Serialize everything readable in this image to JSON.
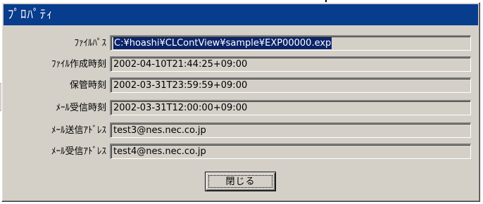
{
  "dialog": {
    "title": "ﾌﾟﾛﾊﾟﾃｨ",
    "colors": {
      "titlebar": "#083c8c",
      "face": "#d4d0c8",
      "selection": "#0a246a"
    }
  },
  "fields": [
    {
      "label": "ﾌｧｲﾙﾊﾟｽ",
      "value": "C:¥hoashi¥CLContView¥sample¥EXP00000.exp",
      "selected": true
    },
    {
      "label": "ﾌｧｲﾙ作成時刻",
      "value": "2002-04-10T21:44:25+09:00"
    },
    {
      "label": "保管時刻",
      "value": "2002-03-31T23:59:59+09:00"
    },
    {
      "label": "ﾒｰﾙ受信時刻",
      "value": "2002-03-31T12:00:00+09:00"
    },
    {
      "label": "ﾒｰﾙ送信ｱﾄﾞﾚｽ",
      "value": "test3@nes.nec.co.jp"
    },
    {
      "label": "ﾒｰﾙ受信ｱﾄﾞﾚｽ",
      "value": "test4@nes.nec.co.jp"
    }
  ],
  "buttons": {
    "close_label": "閉じる"
  }
}
